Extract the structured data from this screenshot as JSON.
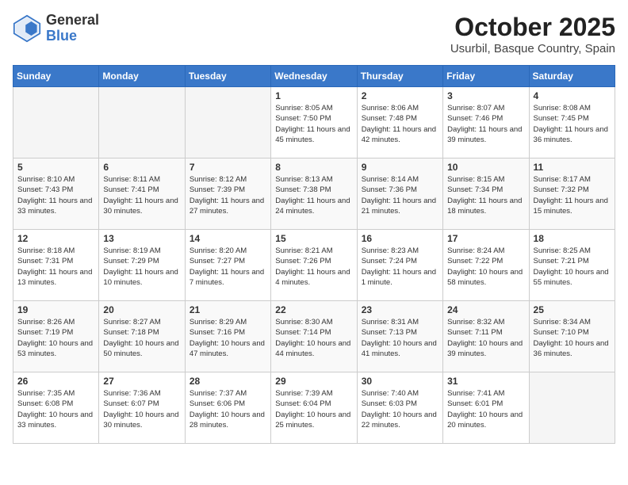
{
  "header": {
    "logo_general": "General",
    "logo_blue": "Blue",
    "title": "October 2025",
    "location": "Usurbil, Basque Country, Spain"
  },
  "days_of_week": [
    "Sunday",
    "Monday",
    "Tuesday",
    "Wednesday",
    "Thursday",
    "Friday",
    "Saturday"
  ],
  "weeks": [
    [
      {
        "day": "",
        "sunrise": "",
        "sunset": "",
        "daylight": ""
      },
      {
        "day": "",
        "sunrise": "",
        "sunset": "",
        "daylight": ""
      },
      {
        "day": "",
        "sunrise": "",
        "sunset": "",
        "daylight": ""
      },
      {
        "day": "1",
        "sunrise": "Sunrise: 8:05 AM",
        "sunset": "Sunset: 7:50 PM",
        "daylight": "Daylight: 11 hours and 45 minutes."
      },
      {
        "day": "2",
        "sunrise": "Sunrise: 8:06 AM",
        "sunset": "Sunset: 7:48 PM",
        "daylight": "Daylight: 11 hours and 42 minutes."
      },
      {
        "day": "3",
        "sunrise": "Sunrise: 8:07 AM",
        "sunset": "Sunset: 7:46 PM",
        "daylight": "Daylight: 11 hours and 39 minutes."
      },
      {
        "day": "4",
        "sunrise": "Sunrise: 8:08 AM",
        "sunset": "Sunset: 7:45 PM",
        "daylight": "Daylight: 11 hours and 36 minutes."
      }
    ],
    [
      {
        "day": "5",
        "sunrise": "Sunrise: 8:10 AM",
        "sunset": "Sunset: 7:43 PM",
        "daylight": "Daylight: 11 hours and 33 minutes."
      },
      {
        "day": "6",
        "sunrise": "Sunrise: 8:11 AM",
        "sunset": "Sunset: 7:41 PM",
        "daylight": "Daylight: 11 hours and 30 minutes."
      },
      {
        "day": "7",
        "sunrise": "Sunrise: 8:12 AM",
        "sunset": "Sunset: 7:39 PM",
        "daylight": "Daylight: 11 hours and 27 minutes."
      },
      {
        "day": "8",
        "sunrise": "Sunrise: 8:13 AM",
        "sunset": "Sunset: 7:38 PM",
        "daylight": "Daylight: 11 hours and 24 minutes."
      },
      {
        "day": "9",
        "sunrise": "Sunrise: 8:14 AM",
        "sunset": "Sunset: 7:36 PM",
        "daylight": "Daylight: 11 hours and 21 minutes."
      },
      {
        "day": "10",
        "sunrise": "Sunrise: 8:15 AM",
        "sunset": "Sunset: 7:34 PM",
        "daylight": "Daylight: 11 hours and 18 minutes."
      },
      {
        "day": "11",
        "sunrise": "Sunrise: 8:17 AM",
        "sunset": "Sunset: 7:32 PM",
        "daylight": "Daylight: 11 hours and 15 minutes."
      }
    ],
    [
      {
        "day": "12",
        "sunrise": "Sunrise: 8:18 AM",
        "sunset": "Sunset: 7:31 PM",
        "daylight": "Daylight: 11 hours and 13 minutes."
      },
      {
        "day": "13",
        "sunrise": "Sunrise: 8:19 AM",
        "sunset": "Sunset: 7:29 PM",
        "daylight": "Daylight: 11 hours and 10 minutes."
      },
      {
        "day": "14",
        "sunrise": "Sunrise: 8:20 AM",
        "sunset": "Sunset: 7:27 PM",
        "daylight": "Daylight: 11 hours and 7 minutes."
      },
      {
        "day": "15",
        "sunrise": "Sunrise: 8:21 AM",
        "sunset": "Sunset: 7:26 PM",
        "daylight": "Daylight: 11 hours and 4 minutes."
      },
      {
        "day": "16",
        "sunrise": "Sunrise: 8:23 AM",
        "sunset": "Sunset: 7:24 PM",
        "daylight": "Daylight: 11 hours and 1 minute."
      },
      {
        "day": "17",
        "sunrise": "Sunrise: 8:24 AM",
        "sunset": "Sunset: 7:22 PM",
        "daylight": "Daylight: 10 hours and 58 minutes."
      },
      {
        "day": "18",
        "sunrise": "Sunrise: 8:25 AM",
        "sunset": "Sunset: 7:21 PM",
        "daylight": "Daylight: 10 hours and 55 minutes."
      }
    ],
    [
      {
        "day": "19",
        "sunrise": "Sunrise: 8:26 AM",
        "sunset": "Sunset: 7:19 PM",
        "daylight": "Daylight: 10 hours and 53 minutes."
      },
      {
        "day": "20",
        "sunrise": "Sunrise: 8:27 AM",
        "sunset": "Sunset: 7:18 PM",
        "daylight": "Daylight: 10 hours and 50 minutes."
      },
      {
        "day": "21",
        "sunrise": "Sunrise: 8:29 AM",
        "sunset": "Sunset: 7:16 PM",
        "daylight": "Daylight: 10 hours and 47 minutes."
      },
      {
        "day": "22",
        "sunrise": "Sunrise: 8:30 AM",
        "sunset": "Sunset: 7:14 PM",
        "daylight": "Daylight: 10 hours and 44 minutes."
      },
      {
        "day": "23",
        "sunrise": "Sunrise: 8:31 AM",
        "sunset": "Sunset: 7:13 PM",
        "daylight": "Daylight: 10 hours and 41 minutes."
      },
      {
        "day": "24",
        "sunrise": "Sunrise: 8:32 AM",
        "sunset": "Sunset: 7:11 PM",
        "daylight": "Daylight: 10 hours and 39 minutes."
      },
      {
        "day": "25",
        "sunrise": "Sunrise: 8:34 AM",
        "sunset": "Sunset: 7:10 PM",
        "daylight": "Daylight: 10 hours and 36 minutes."
      }
    ],
    [
      {
        "day": "26",
        "sunrise": "Sunrise: 7:35 AM",
        "sunset": "Sunset: 6:08 PM",
        "daylight": "Daylight: 10 hours and 33 minutes."
      },
      {
        "day": "27",
        "sunrise": "Sunrise: 7:36 AM",
        "sunset": "Sunset: 6:07 PM",
        "daylight": "Daylight: 10 hours and 30 minutes."
      },
      {
        "day": "28",
        "sunrise": "Sunrise: 7:37 AM",
        "sunset": "Sunset: 6:06 PM",
        "daylight": "Daylight: 10 hours and 28 minutes."
      },
      {
        "day": "29",
        "sunrise": "Sunrise: 7:39 AM",
        "sunset": "Sunset: 6:04 PM",
        "daylight": "Daylight: 10 hours and 25 minutes."
      },
      {
        "day": "30",
        "sunrise": "Sunrise: 7:40 AM",
        "sunset": "Sunset: 6:03 PM",
        "daylight": "Daylight: 10 hours and 22 minutes."
      },
      {
        "day": "31",
        "sunrise": "Sunrise: 7:41 AM",
        "sunset": "Sunset: 6:01 PM",
        "daylight": "Daylight: 10 hours and 20 minutes."
      },
      {
        "day": "",
        "sunrise": "",
        "sunset": "",
        "daylight": ""
      }
    ]
  ]
}
